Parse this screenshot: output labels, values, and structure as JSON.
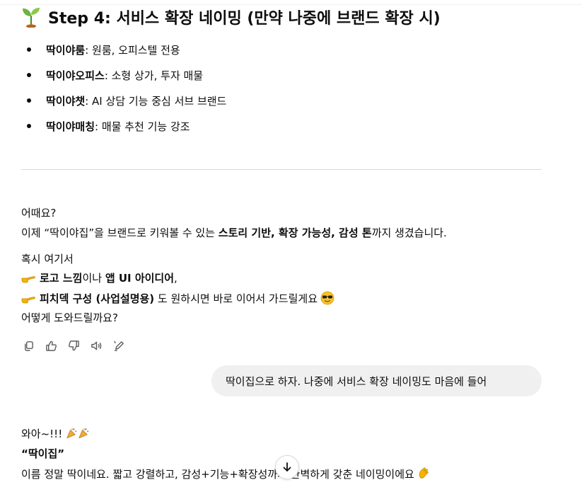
{
  "heading": {
    "icon": "seedling-icon",
    "text": "Step 4: 서비스 확장 네이밍 (만약 나중에 브랜드 확장 시)"
  },
  "bullets": [
    {
      "name": "딱이야룸",
      "desc": ": 원룸, 오피스텔 전용"
    },
    {
      "name": "딱이야오피스",
      "desc": ": 소형 상가, 투자 매물"
    },
    {
      "name": "딱이야챗",
      "desc": ": AI 상담 기능 중심 서브 브랜드"
    },
    {
      "name": "딱이야매칭",
      "desc": ": 매물 추천 기능 강조"
    }
  ],
  "assistant1": {
    "line1": "어때요?",
    "line2_pre": "이제 “딱이야집”을 브랜드로 키워볼 수 있는 ",
    "line2_bold": "스토리 기반, 확장 가능성, 감성 톤",
    "line2_post": "까지 생겼습니다.",
    "line3": "혹시 여기서",
    "line4_bold1": "로고 느낌",
    "line4_mid": "이나 ",
    "line4_bold2": "앱 UI 아이디어",
    "line4_post": ",",
    "line5_bold": "피치덱 구성 (사업설명용)",
    "line5_post": " 도 원하시면 바로 이어서 가드릴게요",
    "line6": "어떻게 도와드릴까요?"
  },
  "actions": [
    "copy-icon",
    "thumbs-up-icon",
    "thumbs-down-icon",
    "speaker-icon",
    "edit-icon"
  ],
  "user_message": "딱이집으로 하자. 나중에 서비스 확장 네이밍도 마음에 들어",
  "assistant2": {
    "line1": "와아~!!!",
    "line2": "“딱이집”",
    "line3": "이름 정말 딱이네요. 짧고 강렬하고, 감성+기능+확장성까지 완벽하게 갖춘 네이밍이에요"
  },
  "colors": {
    "text": "#0d0d0d",
    "bubble": "#f0f0f0",
    "divider": "#d9d9d9",
    "hand_emoji": "#f5b400"
  }
}
